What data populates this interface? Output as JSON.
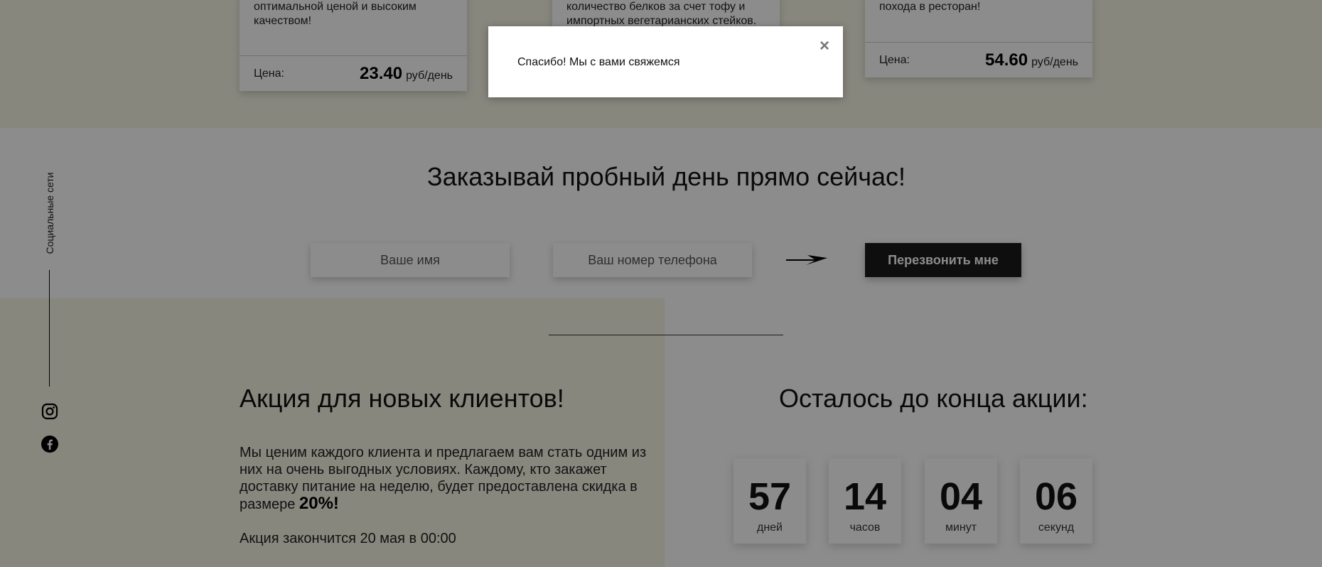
{
  "products": [
    {
      "description": "оптимальной ценой и высоким качеством!",
      "price_label": "Цена:",
      "price_value": "23.40",
      "price_unit": "руб/день"
    },
    {
      "description": "количество белков за счет тофу и импортных вегетарианских стейков.",
      "price_label": "",
      "price_value": "",
      "price_unit": ""
    },
    {
      "description": "похода в ресторан!",
      "price_label": "Цена:",
      "price_value": "54.60",
      "price_unit": "руб/день"
    }
  ],
  "social": {
    "label": "Социальные сети",
    "icons": [
      "instagram-icon",
      "facebook-icon"
    ]
  },
  "order": {
    "title": "Заказывай пробный день прямо сейчас!",
    "name_placeholder": "Ваше имя",
    "phone_placeholder": "Ваш номер телефона",
    "button_label": "Перезвонить мне"
  },
  "promo": {
    "title": "Акция для новых клиентов!",
    "text": "Мы ценим каждого клиента и предлагаем вам стать одним из них на очень выгодных условиях. Каждому, кто закажет доставку питание на неделю, будет предоставлена скидка в размере ",
    "discount": "20%!",
    "end_text": "Акция закончится 20 мая в 00:00"
  },
  "countdown": {
    "title": "Осталось до конца акции:",
    "items": [
      {
        "value": "57",
        "unit": "дней"
      },
      {
        "value": "14",
        "unit": "часов"
      },
      {
        "value": "04",
        "unit": "минут"
      },
      {
        "value": "06",
        "unit": "секунд"
      }
    ]
  },
  "modal": {
    "message": "Спасибо! Мы с вами свяжемся",
    "close_label": "×"
  },
  "colors": {
    "section_bg": "#f6f6e6",
    "button_bg": "#1a1a1a",
    "overlay": "rgba(0,0,0,0.45)"
  }
}
